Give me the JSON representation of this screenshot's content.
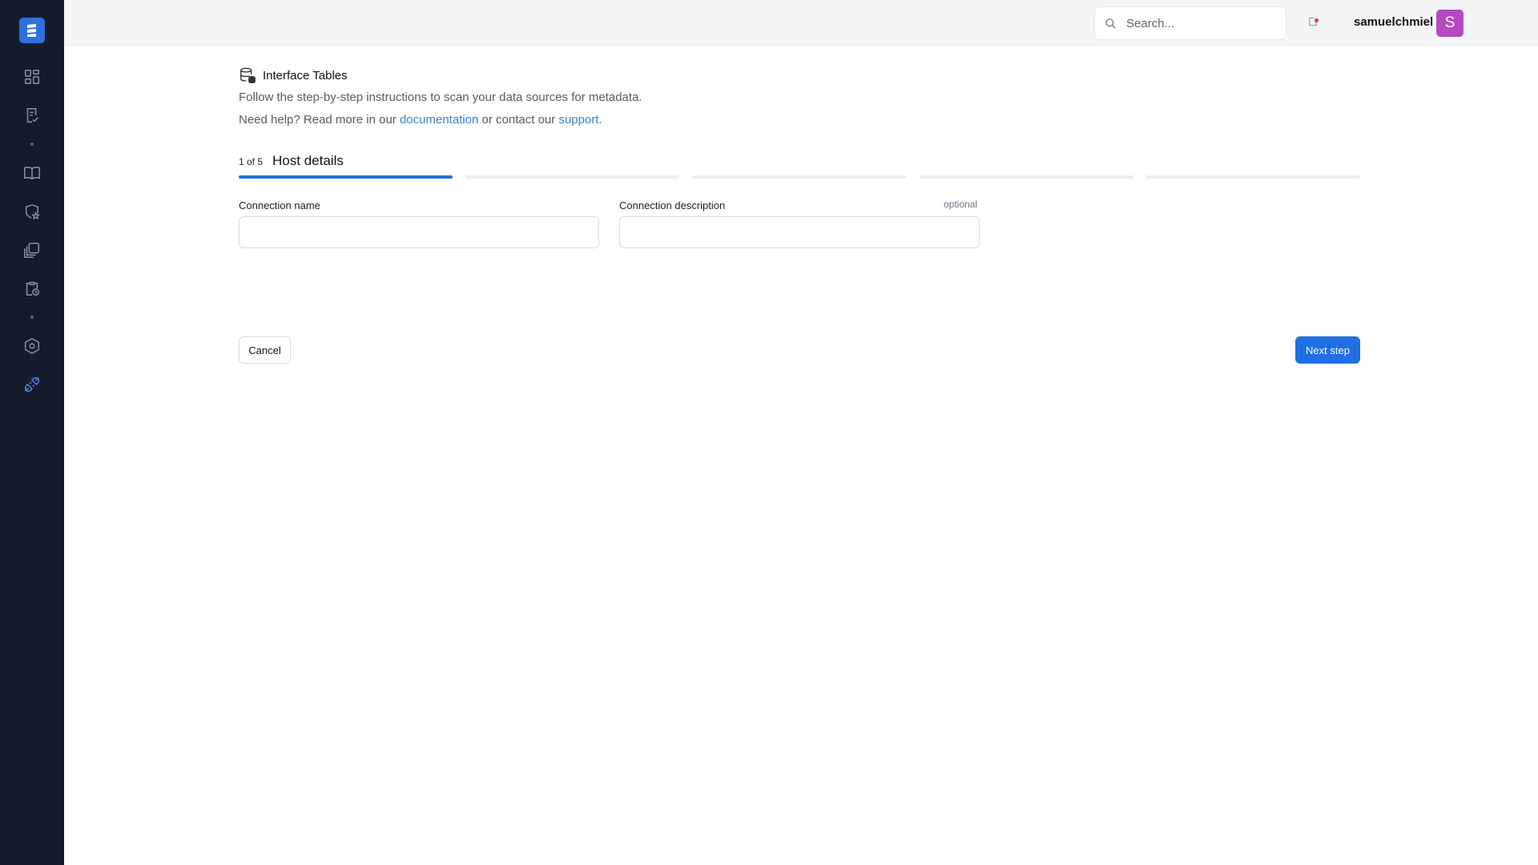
{
  "sidebar": {
    "logo": "app-logo",
    "items": [
      {
        "icon": "dashboard-icon"
      },
      {
        "icon": "checklist-icon"
      },
      {
        "icon": "book-icon"
      },
      {
        "icon": "shield-star-icon"
      },
      {
        "icon": "stacked-copies-icon"
      },
      {
        "icon": "clipboard-clock-icon"
      },
      {
        "icon": "hexagon-settings-icon"
      },
      {
        "icon": "connection-plug-icon",
        "active": true
      }
    ],
    "active_color": "#4a86ee"
  },
  "topbar": {
    "search_placeholder": "Search...",
    "username": "samuelchmiel",
    "avatar_letter": "S",
    "avatar_color": "#b44ac0"
  },
  "page": {
    "title": "Interface Tables",
    "description": "Follow the step-by-step instructions to scan your data sources for metadata.",
    "help_prefix": "Need help? Read more in our ",
    "help_link_docs": "documentation",
    "help_middle": " or contact our ",
    "help_link_support": "support."
  },
  "wizard": {
    "step_count": "1 of 5",
    "step_name": "Host details",
    "current_step": 1,
    "total_steps": 5,
    "accent_color": "#2a6fd6"
  },
  "form": {
    "connection_name_label": "Connection name",
    "connection_name_value": "",
    "connection_description_label": "Connection description",
    "connection_description_value": "",
    "optional_label": "optional"
  },
  "actions": {
    "cancel_label": "Cancel",
    "next_label": "Next step",
    "next_color": "#1f6fe5"
  }
}
